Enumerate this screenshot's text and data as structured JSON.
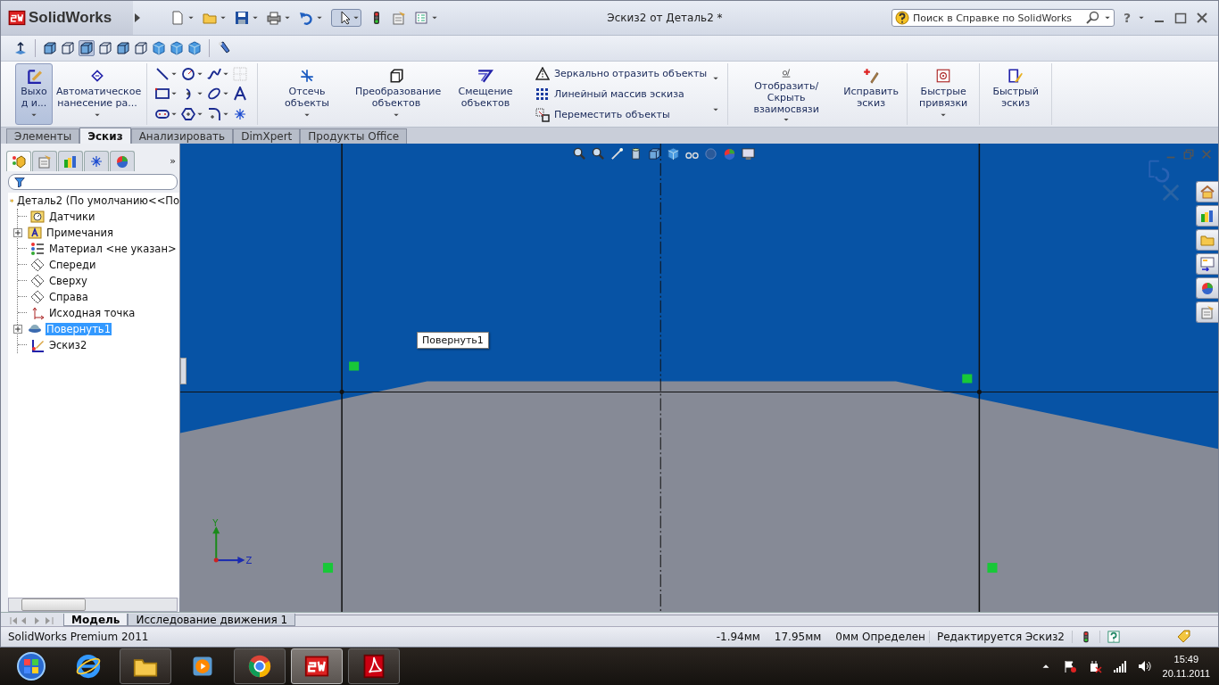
{
  "app": {
    "logo": "SolidWorks",
    "title": "Эскиз2 от Деталь2 *",
    "search": {
      "placeholder": "Поиск в Справке по SolidWorks"
    },
    "help": "?"
  },
  "ribbon": {
    "buttons": [
      {
        "label": "Выхо д и...",
        "kind": "exit",
        "selected": true,
        "has_menu": true
      },
      {
        "label": "Автоматическое нанесение ра...",
        "kind": "dimension",
        "selected": false,
        "has_menu": true
      },
      {
        "label": "Отсечь объекты",
        "kind": "trim",
        "selected": false,
        "has_menu": true
      },
      {
        "label": "Преобразование объектов",
        "kind": "convert",
        "selected": false,
        "has_menu": true
      },
      {
        "label": "Смещение объектов",
        "kind": "offset",
        "selected": false,
        "has_menu": false
      },
      {
        "label": "Отобразить/Скрыть взаимосвязи",
        "kind": "relations",
        "selected": false,
        "has_menu": true
      },
      {
        "label": "Исправить эскиз",
        "kind": "repair",
        "selected": false,
        "has_menu": false
      },
      {
        "label": "Быстрые привязки",
        "kind": "snaps",
        "selected": false,
        "has_menu": true
      },
      {
        "label": "Быстрый эскиз",
        "kind": "quick",
        "selected": false,
        "has_menu": false
      }
    ],
    "commands": [
      {
        "label": "Зеркально отразить объекты",
        "kind": "mirror"
      },
      {
        "label": "Линейный массив эскиза",
        "kind": "pattern"
      },
      {
        "label": "Переместить объекты",
        "kind": "move"
      }
    ]
  },
  "tabs": [
    {
      "label": "Элементы",
      "selected": false
    },
    {
      "label": "Эскиз",
      "selected": true
    },
    {
      "label": "Анализировать",
      "selected": false
    },
    {
      "label": "DimXpert",
      "selected": false
    },
    {
      "label": "Продукты Office",
      "selected": false
    }
  ],
  "feature_tree": {
    "panel_tabs": [
      {
        "selected": true
      },
      {
        "selected": false
      },
      {
        "selected": false
      },
      {
        "selected": false
      },
      {
        "selected": false
      }
    ],
    "more": "»",
    "root": {
      "label": "Деталь2  (По умолчанию<<По",
      "children": [
        {
          "label": "Датчики",
          "kind": "sensors",
          "collapsed": false,
          "selected": false
        },
        {
          "label": "Примечания",
          "kind": "annotations",
          "collapsed": true,
          "selected": false
        },
        {
          "label": "Материал <не указан>",
          "kind": "material",
          "collapsed": false,
          "selected": false
        },
        {
          "label": "Спереди",
          "kind": "plane",
          "collapsed": false,
          "selected": false
        },
        {
          "label": "Сверху",
          "kind": "plane",
          "collapsed": false,
          "selected": false
        },
        {
          "label": "Справа",
          "kind": "plane",
          "collapsed": false,
          "selected": false
        },
        {
          "label": "Исходная точка",
          "kind": "origin",
          "collapsed": false,
          "selected": false
        },
        {
          "label": "Повернуть1",
          "kind": "revolve",
          "collapsed": true,
          "selected": true
        },
        {
          "label": "Эскиз2",
          "kind": "sketch",
          "collapsed": false,
          "selected": false
        }
      ]
    }
  },
  "viewport": {
    "tooltip": "Повернуть1",
    "triad": {
      "y": "Y",
      "z": "Z"
    }
  },
  "model_tabs": [
    {
      "label": "Модель",
      "selected": true
    },
    {
      "label": "Исследование движения 1",
      "selected": false
    }
  ],
  "status_bar": {
    "product": "SolidWorks Premium 2011",
    "x": "-1.94мм",
    "y": "17.95мм",
    "z": "0мм",
    "state": "Определен",
    "mode": "Редактируется Эскиз2"
  },
  "taskbar": {
    "apps": [
      {
        "running": false,
        "selected": false
      },
      {
        "running": true,
        "selected": false
      },
      {
        "running": false,
        "selected": false
      },
      {
        "running": true,
        "selected": false
      },
      {
        "running": true,
        "selected": true
      },
      {
        "running": true,
        "selected": false
      }
    ],
    "time": "15:49",
    "date": "20.11.2011"
  }
}
